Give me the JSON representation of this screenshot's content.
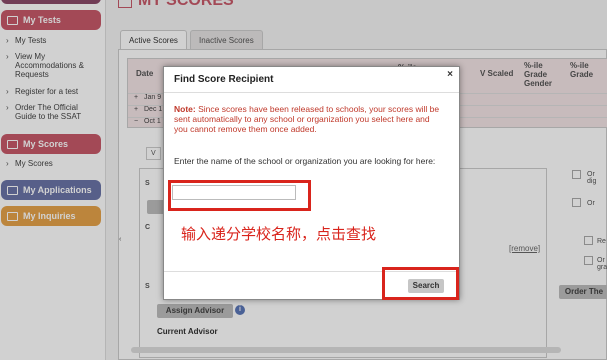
{
  "sidebar": {
    "my_tests_header": "My Tests",
    "my_tests_links": [
      "My Tests",
      "View My Accommodations & Requests",
      "Register for a test",
      "Order The Official Guide to the SSAT"
    ],
    "my_scores_header": "My Scores",
    "my_scores_links": [
      "My Scores"
    ],
    "my_applications_header": "My Applications",
    "my_inquiries_header": "My Inquiries",
    "colors": {
      "my_tests": "#c75a6a",
      "my_scores": "#c75a6a",
      "my_applications": "#6b75a8",
      "my_inquiries": "#e6a34a"
    }
  },
  "page": {
    "title": "MY SCORES",
    "tabs": [
      "Active Scores",
      "Inactive Scores"
    ]
  },
  "table": {
    "headers": [
      "Date",
      "%-ile",
      "V Scaled",
      "%-ile Grade Gender",
      "%-ile Grade"
    ],
    "rows": [
      {
        "toggle": "+",
        "date": "Jan 9"
      },
      {
        "toggle": "+",
        "date": "Dec 1"
      },
      {
        "toggle": "−",
        "date": "Oct 1"
      }
    ]
  },
  "background": {
    "select_label": "V",
    "section_label_1": "S",
    "section_label_2": "S",
    "section_label_c": "C",
    "remove_link": "[remove]",
    "assign_advisor_button": "Assign Advisor",
    "current_advisor_label": "Current Advisor",
    "order_button": "Order The",
    "option_labels": [
      "Or dig",
      "Or",
      "Re",
      "Or gra"
    ]
  },
  "dialog": {
    "title": "Find Score Recipient",
    "close": "×",
    "note_label": "Note:",
    "note_text": "Since scores have been released to schools, your scores will be sent automatically to any school or organization you select here and you cannot remove them once added.",
    "prompt": "Enter the name of the school or organization you are looking for here:",
    "input_value": "",
    "search_button": "Search",
    "annotation": "输入递分学校名称，点击查找",
    "highlight_color": "#d9241c"
  }
}
